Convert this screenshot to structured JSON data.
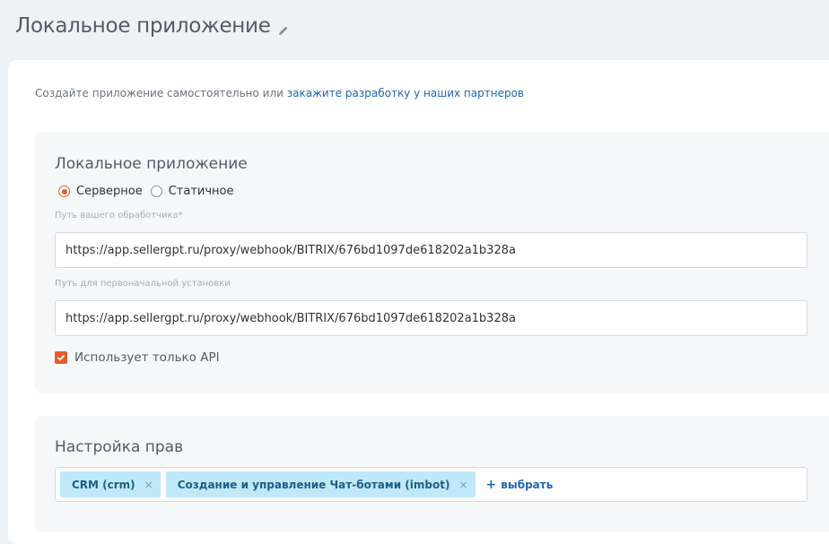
{
  "header": {
    "title": "Локальное приложение",
    "edit_icon": "pencil-icon"
  },
  "intro": {
    "text": "Создайте приложение самостоятельно или ",
    "link": "закажите разработку у наших партнеров"
  },
  "app_panel": {
    "title": "Локальное приложение",
    "radios": [
      {
        "label": "Серверное",
        "checked": true
      },
      {
        "label": "Статичное",
        "checked": false
      }
    ],
    "handler_path": {
      "label": "Путь вашего обработчика*",
      "value": "https://app.sellergpt.ru/proxy/webhook/BITRIX/676bd1097de618202a1b328a"
    },
    "install_path": {
      "label": "Путь для первоначальной установки",
      "value": "https://app.sellergpt.ru/proxy/webhook/BITRIX/676bd1097de618202a1b328a"
    },
    "api_only": {
      "label": "Использует только API",
      "checked": true
    }
  },
  "rights_panel": {
    "title": "Настройка прав",
    "tags": [
      {
        "label": "CRM (crm)"
      },
      {
        "label": "Создание и управление Чат-ботами (imbot)"
      }
    ],
    "remove_symbol": "×",
    "add_label": "выбрать",
    "add_symbol": "+"
  },
  "colors": {
    "accent": "#e65d2a",
    "link": "#2067b0",
    "tag_bg": "#bfe8f8"
  }
}
